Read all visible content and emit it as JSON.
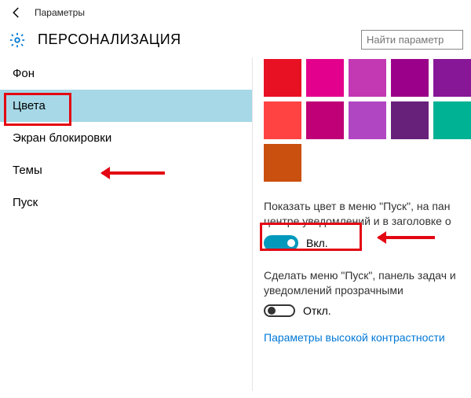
{
  "window": {
    "title": "Параметры"
  },
  "page_title": "ПЕРСОНАЛИЗАЦИЯ",
  "search": {
    "placeholder": "Найти параметр"
  },
  "sidebar": {
    "items": [
      {
        "label": "Фон"
      },
      {
        "label": "Цвета"
      },
      {
        "label": "Экран блокировки"
      },
      {
        "label": "Темы"
      },
      {
        "label": "Пуск"
      }
    ],
    "selected_index": 1
  },
  "swatches": {
    "row1": [
      "#e81123",
      "#e3008c",
      "#c239b3",
      "#9a0089",
      "#881798"
    ],
    "row2": [
      "#ff4343",
      "#bf0077",
      "#b146c2",
      "#68217a",
      "#00b294"
    ],
    "row3": [
      "#ca5010"
    ]
  },
  "settings": {
    "show_color": {
      "text": "Показать цвет в меню \"Пуск\", на пан\nцентре уведомлений и в заголовке о",
      "value": true,
      "state_label": "Вкл."
    },
    "transparency": {
      "text": "Сделать меню \"Пуск\", панель задач и\nуведомлений прозрачными",
      "value": false,
      "state_label": "Откл."
    }
  },
  "link": {
    "label": "Параметры высокой контрастности"
  }
}
